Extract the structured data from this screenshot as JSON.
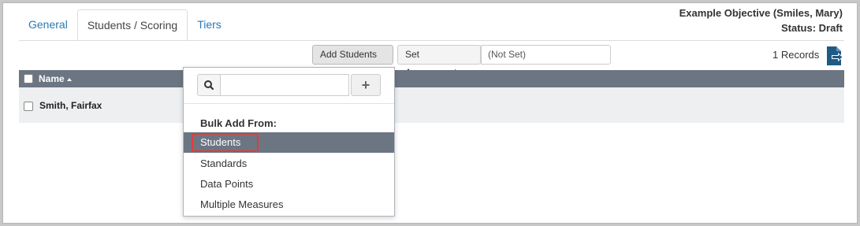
{
  "tabs": [
    {
      "label": "General",
      "active": false
    },
    {
      "label": "Students / Scoring",
      "active": true
    },
    {
      "label": "Tiers",
      "active": false
    }
  ],
  "objective": {
    "title": "Example Objective (Smiles, Mary)",
    "status": "Status: Draft"
  },
  "toolbar": {
    "add_students_label": "Add Students",
    "set_assessment_label": "Set Assessment",
    "assessment_value": "(Not Set)",
    "records_count": "1 Records"
  },
  "table": {
    "columns": [
      {
        "label": "Name",
        "sort": "ascending"
      }
    ],
    "rows": [
      {
        "name": "Smith, Fairfax"
      }
    ]
  },
  "dropdown": {
    "search_placeholder": "",
    "section_header": "Bulk Add From:",
    "items": [
      {
        "label": "Students",
        "active": true,
        "highlighted": true
      },
      {
        "label": "Standards",
        "active": false
      },
      {
        "label": "Data Points",
        "active": false
      },
      {
        "label": "Multiple Measures",
        "active": false
      }
    ]
  },
  "colors": {
    "accent_link": "#2a7ab0",
    "header_bg": "#6c7682",
    "row_bg": "#edeff1",
    "highlight_border": "#e03c3c",
    "export_icon": "#1f5a85"
  },
  "icons": {
    "search": "search-icon",
    "add": "plus-icon",
    "export": "export-file-icon",
    "dropdown": "caret-down-icon",
    "sort": "sort-ascending-icon"
  }
}
